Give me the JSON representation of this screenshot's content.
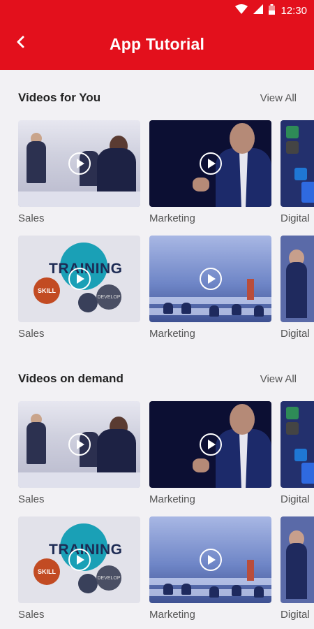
{
  "status": {
    "time": "12:30"
  },
  "appbar": {
    "title": "App Tutorial",
    "back_icon": "chevron-left-icon"
  },
  "colors": {
    "brand": "#e3101c",
    "background": "#f2f1f4"
  },
  "sections": [
    {
      "title": "Videos for You",
      "view_all": "View All",
      "rows": [
        [
          {
            "label": "Sales"
          },
          {
            "label": "Marketing"
          },
          {
            "label": "Digital"
          }
        ],
        [
          {
            "label": "Sales"
          },
          {
            "label": "Marketing"
          },
          {
            "label": "Digital"
          }
        ]
      ]
    },
    {
      "title": "Videos on demand",
      "view_all": "View All",
      "rows": [
        [
          {
            "label": "Sales"
          },
          {
            "label": "Marketing"
          },
          {
            "label": "Digital"
          }
        ],
        [
          {
            "label": "Sales"
          },
          {
            "label": "Marketing"
          },
          {
            "label": "Digital"
          }
        ]
      ]
    }
  ],
  "thumbnail_art": {
    "training_text": "TRAINING",
    "skill_text": "SKILL",
    "develop_text": "DEVELOP"
  }
}
